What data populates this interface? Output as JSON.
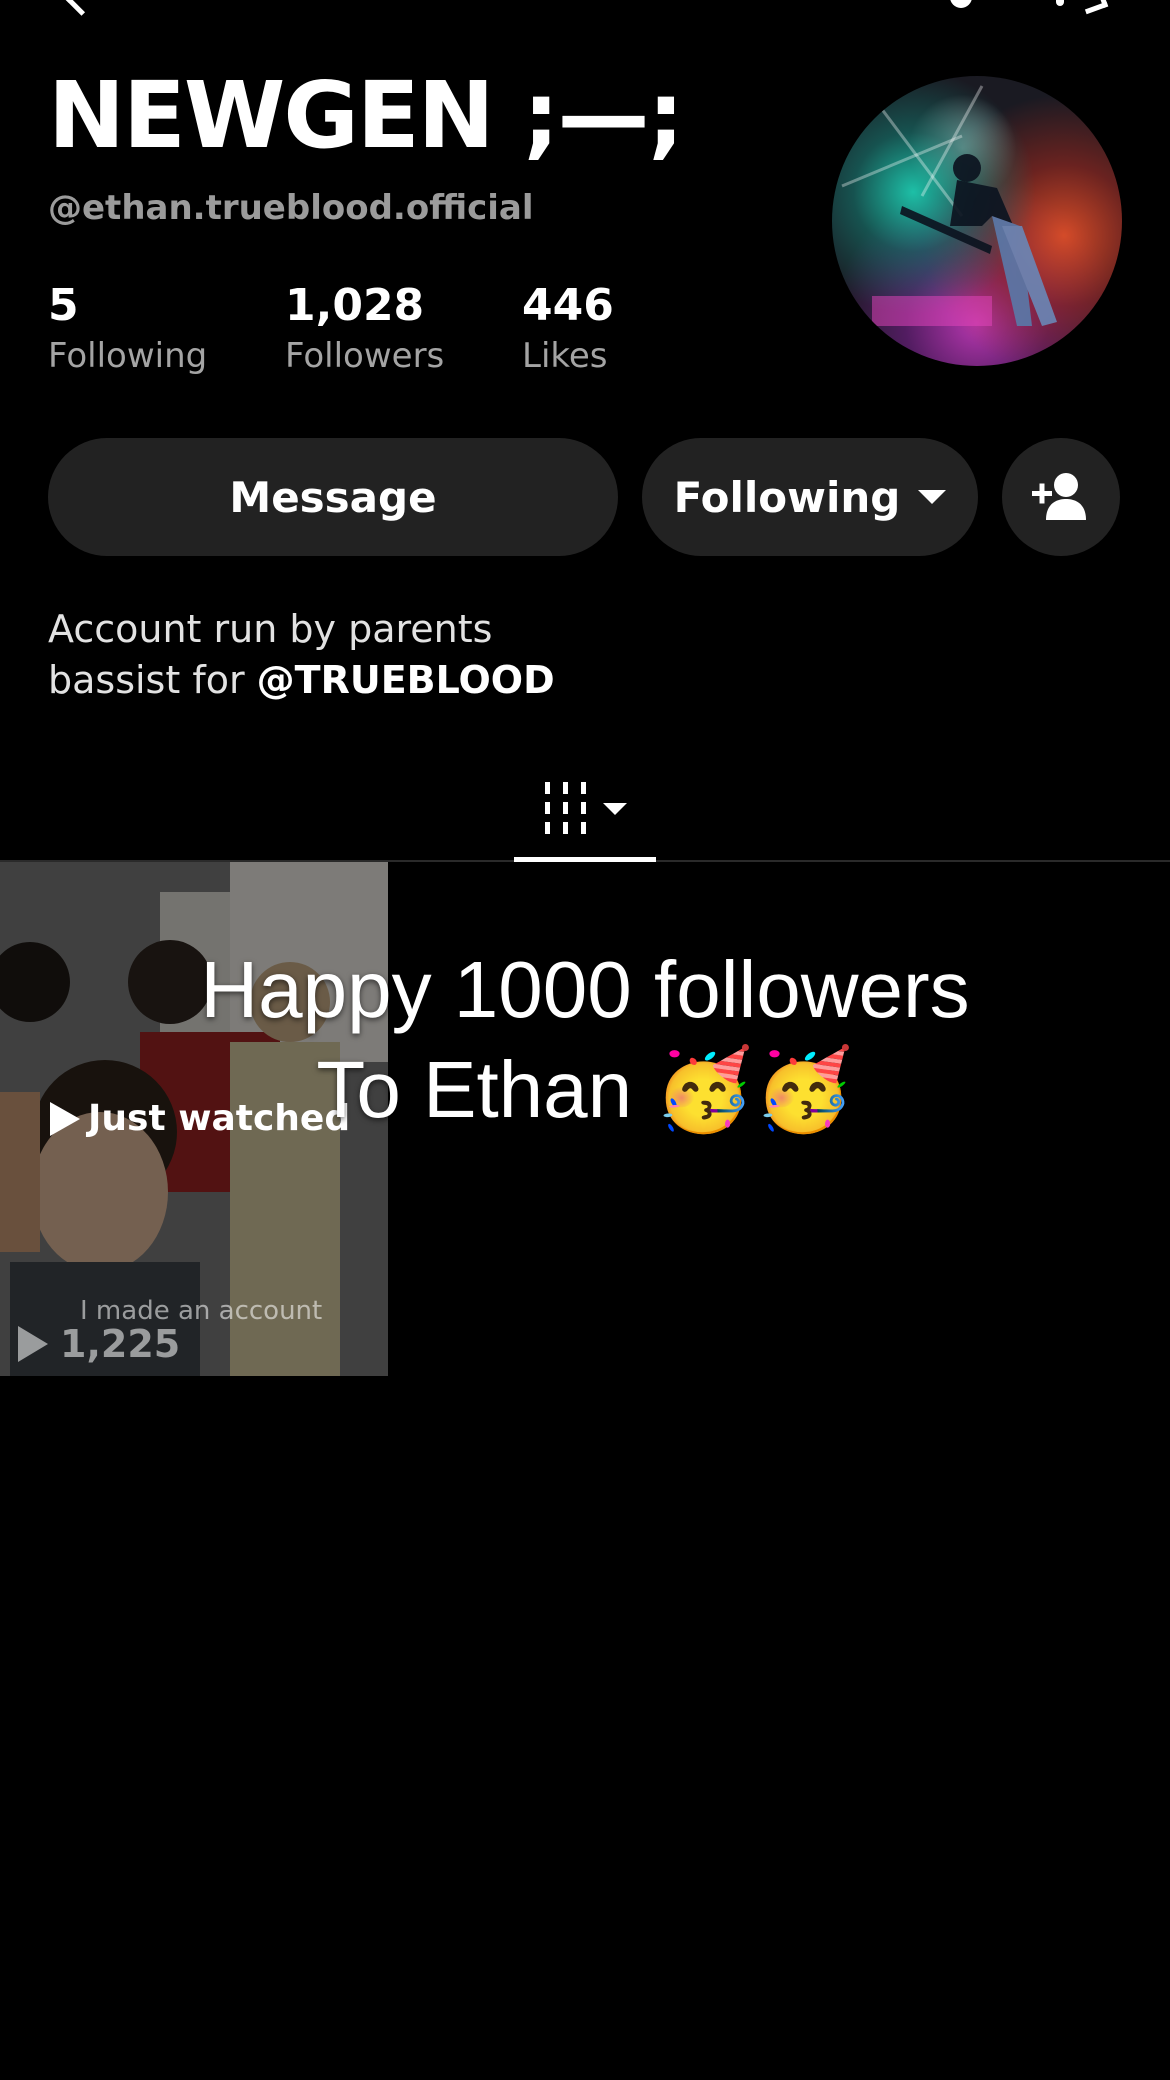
{
  "profile": {
    "display_name": "NEWGEN ;—;",
    "username": "@ethan.trueblood.official",
    "avatar_icon": "profile-photo-bassist-on-stage"
  },
  "stats": [
    {
      "value": "5",
      "label": "Following"
    },
    {
      "value": "1,028",
      "label": "Followers"
    },
    {
      "value": "446",
      "label": "Likes"
    }
  ],
  "actions": {
    "message_label": "Message",
    "following_label": "Following",
    "add_friend_icon": "add-friend-icon"
  },
  "bio": {
    "line1": "Account run by parents",
    "line2_prefix": "bassist for ",
    "line2_mention": "@TRUEBLOOD"
  },
  "tabs": {
    "active_icon": "grid-view-icon"
  },
  "videos": [
    {
      "badge": "Just watched",
      "caption": "I made an account",
      "views": "1,225"
    }
  ],
  "overlay": {
    "line1": "Happy 1000 followers",
    "line2": "To Ethan 🥳🥳"
  },
  "colors": {
    "background": "#000000",
    "button_bg": "#222222",
    "secondary_text": "#9b9b9b"
  }
}
